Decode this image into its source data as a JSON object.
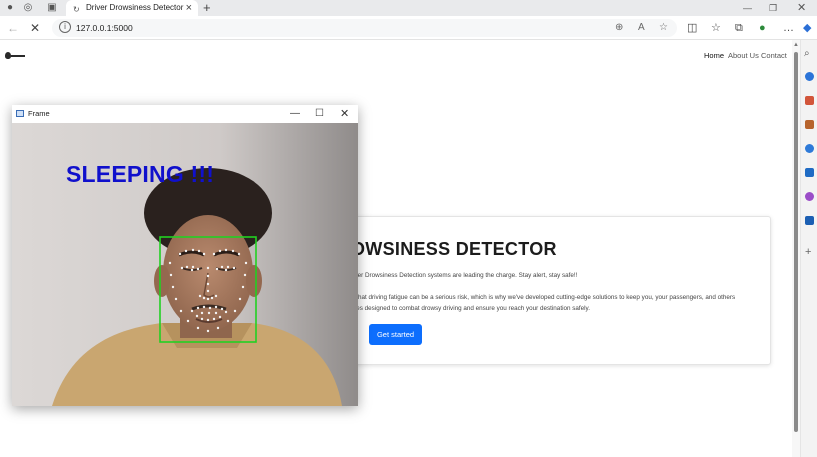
{
  "browser": {
    "tab_title": "Driver Drowsiness Detector",
    "url": "127.0.0.1:5000"
  },
  "site": {
    "nav": [
      "Home",
      "About Us",
      "Contact"
    ],
    "hero": {
      "title": "OWSINESS DETECTOR",
      "line1": "river Drowsiness Detection systems are leading the charge. Stay alert, stay safe!!",
      "line2": "d that driving fatigue can be a serious risk, which is why we've developed cutting-edge solutions to keep you, your passengers, and others",
      "line3": "rces designed to combat drowsy driving and ensure you reach your destination safely.",
      "button": "Get started"
    }
  },
  "frame_window": {
    "title": "Frame",
    "status": "SLEEPING !!!",
    "status_color": "#1010cc",
    "box_color": "#22d022"
  },
  "colors": {
    "accent": "#0d6efd"
  }
}
